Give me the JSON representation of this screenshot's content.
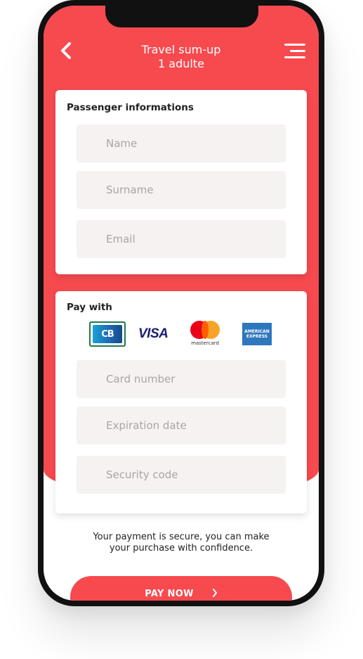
{
  "header": {
    "title_line1": "Travel sum-up",
    "title_line2": "1 adulte",
    "back_icon": "chevron-left-icon",
    "menu_icon": "hamburger-menu-icon"
  },
  "passenger": {
    "title": "Passenger informations",
    "fields": [
      {
        "placeholder": "Name"
      },
      {
        "placeholder": "Surname"
      },
      {
        "placeholder": "Email"
      }
    ]
  },
  "payment": {
    "title": "Pay with",
    "methods": [
      {
        "name": "CB",
        "label": "CB",
        "selected": true
      },
      {
        "name": "Visa",
        "label": "VISA",
        "selected": false
      },
      {
        "name": "Mastercard",
        "label": "mastercard",
        "selected": false
      },
      {
        "name": "American Express",
        "label_line1": "AMERICAN",
        "label_line2": "EXPRESS",
        "selected": false
      }
    ],
    "fields": [
      {
        "placeholder": "Card number"
      },
      {
        "placeholder": "Expiration date"
      },
      {
        "placeholder": "Security code"
      }
    ]
  },
  "secure_message_line1": "Your payment is secure, you can make",
  "secure_message_line2": "your purchase with confidence.",
  "pay_button": {
    "label": "PAY NOW",
    "icon": "chevron-right-icon"
  },
  "colors": {
    "accent": "#f64a4f",
    "field_bg": "#f5f2f1",
    "cb_border": "#1e7a4c"
  }
}
